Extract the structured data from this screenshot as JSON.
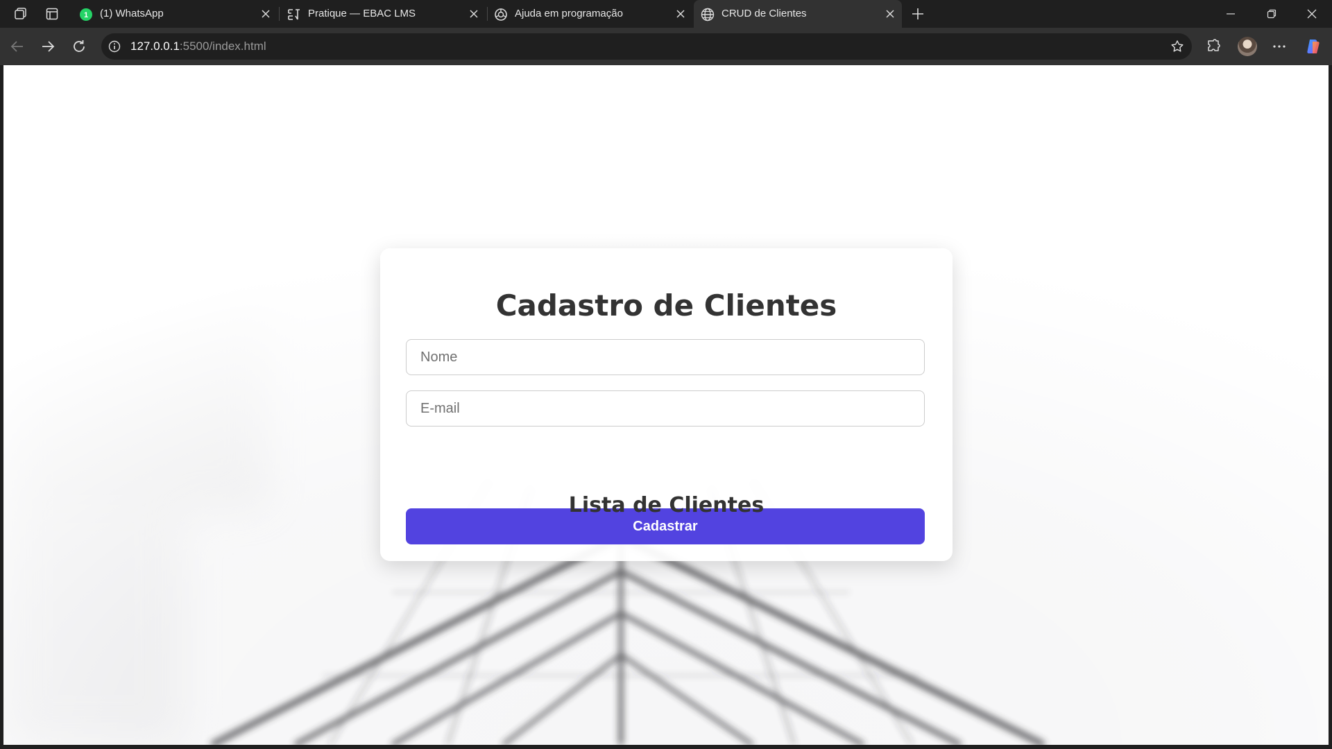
{
  "browser": {
    "tabs": [
      {
        "title": "(1) WhatsApp",
        "icon": "whatsapp-icon",
        "active": false
      },
      {
        "title": "Pratique — EBAC LMS",
        "icon": "ebac-icon",
        "active": false
      },
      {
        "title": "Ajuda em programação",
        "icon": "chatgpt-icon",
        "active": false
      },
      {
        "title": "CRUD de Clientes",
        "icon": "globe-icon",
        "active": true
      }
    ],
    "address": {
      "host": "127.0.0.1",
      "rest": ":5500/index.html"
    }
  },
  "page": {
    "title": "Cadastro de Clientes",
    "name_placeholder": "Nome",
    "email_placeholder": "E-mail",
    "submit_label": "Cadastrar",
    "list_title": "Lista de Clientes"
  },
  "colors": {
    "accent": "#5243e0",
    "chrome_dark": "#1f1f1f",
    "chrome_toolbar": "#323232",
    "heading": "#333333"
  }
}
